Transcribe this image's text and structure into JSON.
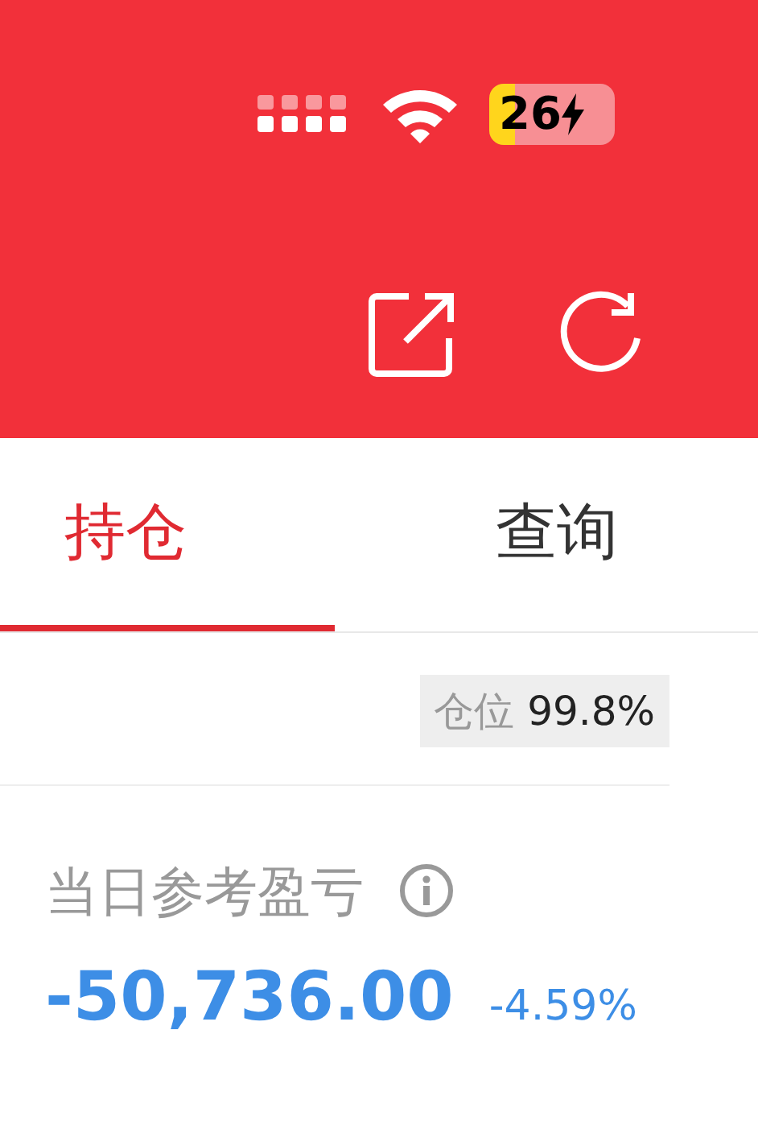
{
  "status_bar": {
    "battery": "26"
  },
  "tabs": [
    {
      "label": "持仓",
      "selected": true
    },
    {
      "label": "查询",
      "selected": false
    }
  ],
  "position": {
    "label": "仓位",
    "value": "99.8%"
  },
  "pnl": {
    "label": "当日参考盈亏",
    "amount": "-50,736.00",
    "percent": "-4.59%"
  }
}
